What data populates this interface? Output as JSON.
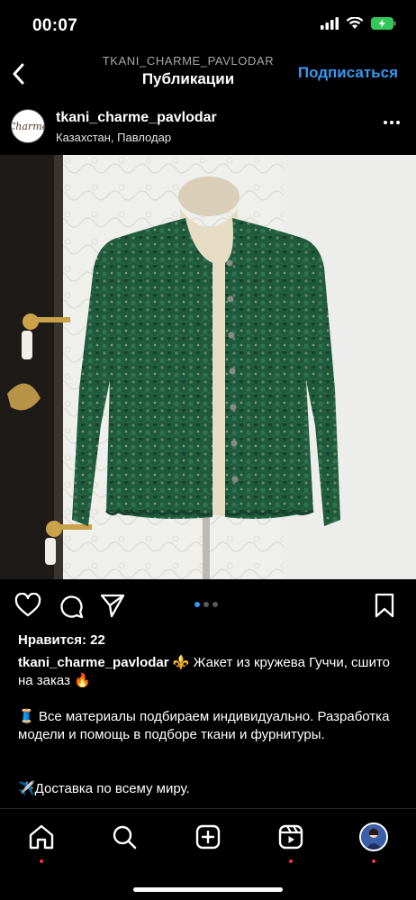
{
  "status": {
    "time": "00:07"
  },
  "header": {
    "username_caps": "TKANI_CHARME_PAVLODAR",
    "title": "Публикации",
    "subscribe": "Подписаться"
  },
  "post": {
    "username": "tkani_charme_pavlodar",
    "location": "Казахстан, Павлодар",
    "avatar_text": "Charme",
    "likes": "Нравится: 22",
    "caption_user": "tkani_charme_pavlodar",
    "caption_text": "⚜️ Жакет из кружева Гуччи, сшито на заказ 🔥",
    "para1": "🧵 Все материалы подбираем индивидуально. Разработка модели и помощь в подборе ткани и фурнитуры.",
    "para2": "✈️Доставка по всему миру.",
    "carousel": {
      "count": 3,
      "active_index": 1
    }
  },
  "colors": {
    "accent": "#3897f0",
    "background": "#000000",
    "jacket": "#1f5a3c",
    "notification": "#ff3040"
  },
  "icons": [
    "back-arrow-icon",
    "more-dots-icon",
    "heart-icon",
    "comment-icon",
    "share-icon",
    "bookmark-icon",
    "home-icon",
    "search-icon",
    "add-post-icon",
    "reels-icon",
    "profile-avatar"
  ]
}
